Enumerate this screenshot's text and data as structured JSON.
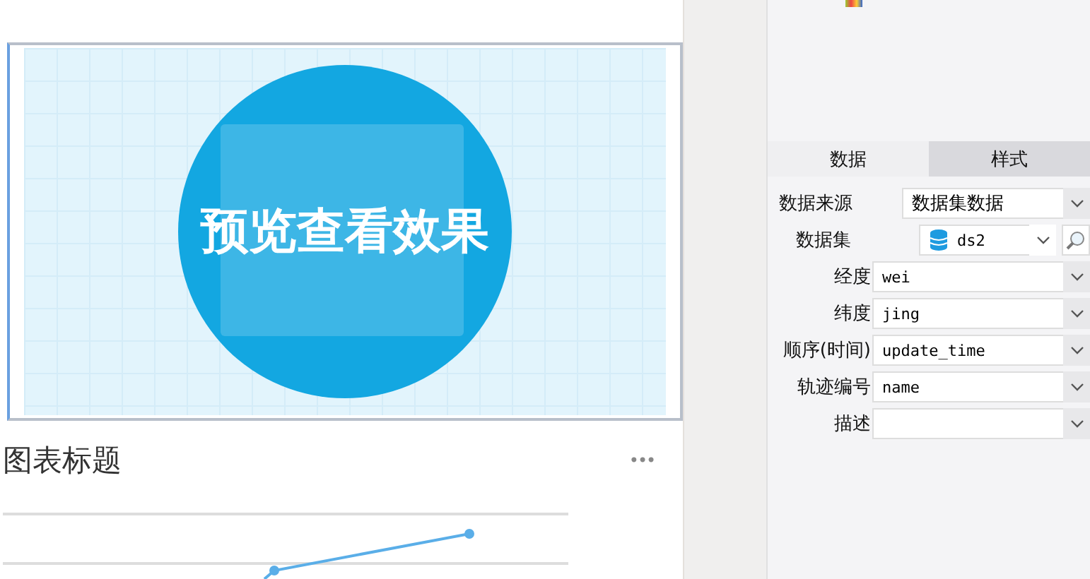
{
  "preview": {
    "caption": "预览查看效果"
  },
  "chart_card": {
    "title": "图表标题",
    "menu": "•••"
  },
  "panel": {
    "tabs": [
      {
        "label": "数据",
        "selected": true
      },
      {
        "label": "样式",
        "selected": false
      }
    ],
    "fields": [
      {
        "kind": "wide",
        "label": "数据来源",
        "value": "数据集数据"
      },
      {
        "kind": "dataset",
        "label": "数据集",
        "value": "ds2"
      },
      {
        "kind": "select",
        "label": "经度",
        "value": "wei"
      },
      {
        "kind": "select",
        "label": "纬度",
        "value": "jing"
      },
      {
        "kind": "select",
        "label": "顺序(时间)",
        "value": "update_time"
      },
      {
        "kind": "select",
        "label": "轨迹编号",
        "value": "name"
      },
      {
        "kind": "select",
        "label": "描述"
      }
    ]
  }
}
